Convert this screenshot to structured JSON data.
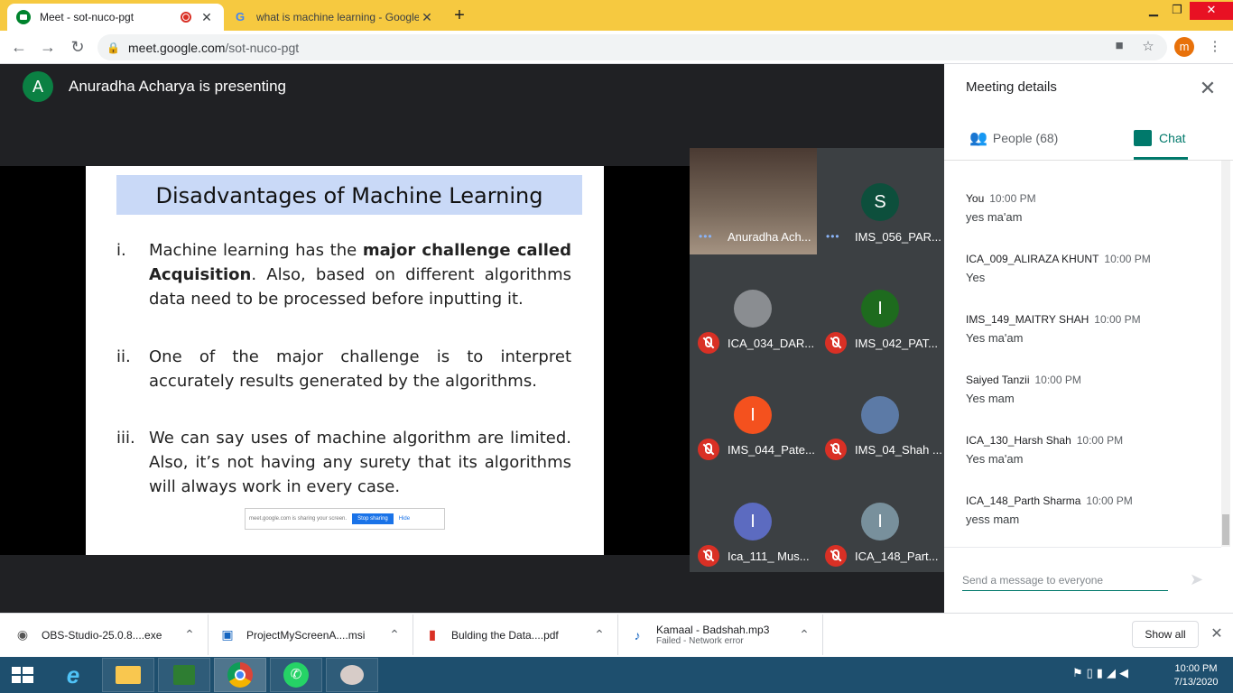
{
  "browser": {
    "tabs": [
      {
        "title": "Meet - sot-nuco-pgt",
        "active": true,
        "recording": true
      },
      {
        "title": "what is machine learning - Google",
        "active": false
      }
    ],
    "new_tab_label": "+",
    "url_host": "meet.google.com",
    "url_path": "/sot-nuco-pgt",
    "profile_initial": "m"
  },
  "meet": {
    "presenter_initial": "A",
    "presenting_text": "Anuradha Acharya is presenting",
    "slide": {
      "title": "Disadvantages of Machine Learning",
      "items": [
        {
          "num": "i.",
          "text_before": "Machine learning has the ",
          "bold1": "major challenge called",
          "bold2": "Acquisition",
          "text_after": ". Also, based on different algorithms data need to be processed before inputting it."
        },
        {
          "num": "ii.",
          "text": "One of the major challenge is to interpret accurately results generated by the algorithms."
        },
        {
          "num": "iii.",
          "text": "We can say uses of machine algorithm are limited. Also, it’s not having any surety that its algorithms will always work in every case."
        }
      ],
      "sharing_notice": "meet.google.com is sharing your screen.",
      "stop_sharing": "Stop sharing",
      "hide": "Hide"
    },
    "participants": [
      {
        "name": "Anuradha Ach...",
        "initial": "",
        "color": "#6d5a4e",
        "muted": false,
        "photo": true
      },
      {
        "name": "IMS_056_PAR...",
        "initial": "S",
        "color": "#0d4f3c",
        "muted": false
      },
      {
        "name": "ICA_034_DAR...",
        "initial": "",
        "color": "#8a8d91",
        "muted": true,
        "photo": true
      },
      {
        "name": "IMS_042_PAT...",
        "initial": "I",
        "color": "#1e6b1e",
        "muted": true
      },
      {
        "name": "IMS_044_Pate...",
        "initial": "I",
        "color": "#f4511e",
        "muted": true
      },
      {
        "name": "IMS_04_Shah ...",
        "initial": "",
        "color": "#5c7aa6",
        "muted": true,
        "photo": true
      },
      {
        "name": "Ica_111_ Mus...",
        "initial": "I",
        "color": "#5c6bc0",
        "muted": true
      },
      {
        "name": "ICA_148_Part...",
        "initial": "I",
        "color": "#78909c",
        "muted": true
      }
    ]
  },
  "panel": {
    "title": "Meeting details",
    "people_tab": "People (68)",
    "chat_tab": "Chat",
    "messages": [
      {
        "sender": "You",
        "time": "10:00 PM",
        "text": "yes ma'am"
      },
      {
        "sender": "ICA_009_ALIRAZA KHUNT",
        "time": "10:00 PM",
        "text": "Yes"
      },
      {
        "sender": "IMS_149_MAITRY SHAH",
        "time": "10:00 PM",
        "text": "Yes ma'am"
      },
      {
        "sender": "Saiyed Tanzii",
        "time": "10:00 PM",
        "text": "Yes mam"
      },
      {
        "sender": "ICA_130_Harsh Shah",
        "time": "10:00 PM",
        "text": "Yes ma'am"
      },
      {
        "sender": "ICA_148_Parth Sharma",
        "time": "10:00 PM",
        "text": "yess mam"
      }
    ],
    "input_placeholder": "Send a message to everyone"
  },
  "downloads": {
    "items": [
      {
        "name": "OBS-Studio-25.0.8....exe",
        "sub": "",
        "icon": "obs-icon"
      },
      {
        "name": "ProjectMyScreenA....msi",
        "sub": "",
        "icon": "installer-icon"
      },
      {
        "name": "Bulding the Data....pdf",
        "sub": "",
        "icon": "pdf-icon"
      },
      {
        "name": "Kamaal - Badshah.mp3",
        "sub": "Failed - Network error",
        "icon": "audio-file-icon"
      }
    ],
    "show_all": "Show all"
  },
  "taskbar": {
    "time": "10:00 PM",
    "date": "7/13/2020"
  },
  "colors": {
    "tabstrip": "#f6c940",
    "meet_bg": "#202124",
    "accent_teal": "#00796b",
    "mic_off_red": "#d93025",
    "taskbar": "#1e4f6e"
  }
}
